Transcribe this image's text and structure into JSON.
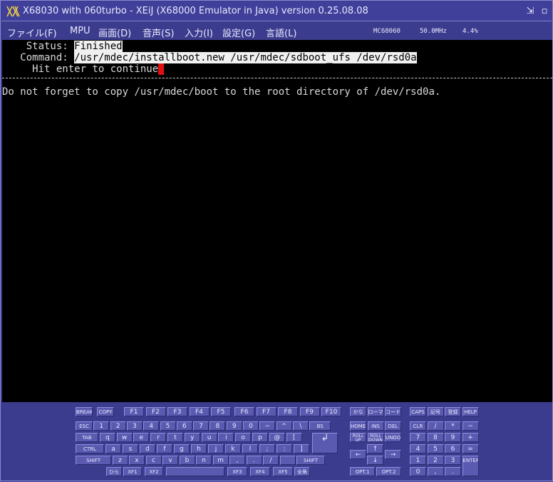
{
  "window": {
    "title": "X68030 with 060turbo - XEiJ (X68000 Emulator in Java) version 0.25.08.08",
    "logo_icon": "x68k-logo-icon",
    "restore_icon": "⇲",
    "close_icon": "▫"
  },
  "menu": {
    "file": "ファイル(F)",
    "mpu": "MPU",
    "screen": "画面(D)",
    "sound": "音声(S)",
    "input": "入力(I)",
    "settings": "設定(G)",
    "language": "言語(L)"
  },
  "status": {
    "cpu": "MC68060",
    "clock": "50.0MHz",
    "load": "4.4%"
  },
  "terminal": {
    "status_label": "    Status: ",
    "status_value": "Finished",
    "command_label": "   Command: ",
    "command_value": "/usr/mdec/installboot.new /usr/mdec/sdboot_ufs /dev/rsd0a",
    "prompt": "     Hit enter to continue",
    "message": "Do not forget to copy /usr/mdec/boot to the root directory of /dev/rsd0a.",
    "cursor_color": "#e01010"
  },
  "keyboard": {
    "row0_left": [
      "BREAK",
      "COPY"
    ],
    "function_keys_a": [
      "F1",
      "F2",
      "F3",
      "F4",
      "F5"
    ],
    "function_keys_b": [
      "F6",
      "F7",
      "F8",
      "F9",
      "F10"
    ],
    "mode_keys": [
      "かな",
      "ローマ",
      "コード"
    ],
    "row0_right": [
      "CAPS",
      "記号",
      "登録",
      "HELP"
    ],
    "row1": [
      "ESC",
      "1",
      "2",
      "3",
      "4",
      "5",
      "6",
      "7",
      "8",
      "9",
      "0",
      "−",
      "^",
      "\\",
      "BS"
    ],
    "row2": [
      "TAB",
      "q",
      "w",
      "e",
      "r",
      "t",
      "y",
      "u",
      "i",
      "o",
      "p",
      "@",
      "["
    ],
    "row3": [
      "CTRL",
      "a",
      "s",
      "d",
      "f",
      "g",
      "h",
      "j",
      "k",
      "l",
      ";",
      ":",
      "]"
    ],
    "row4": [
      "SHIFT",
      "z",
      "x",
      "c",
      "v",
      "b",
      "n",
      "m",
      ",",
      ".",
      "/",
      "",
      "SHIFT"
    ],
    "row5": [
      "ひら",
      "XF1",
      "XF2",
      "",
      "XF3",
      "XF4",
      "XF5",
      "全角"
    ],
    "enter": "↲",
    "nav_top": [
      "HOME",
      "INS",
      "DEL"
    ],
    "nav_mid": [
      "ROLL UP",
      "ROLL DOWN",
      "UNDO"
    ],
    "arrows": [
      "↑",
      "←",
      "→",
      "↓"
    ],
    "opt": [
      "OPT.1",
      "OPT.2"
    ],
    "numpad": [
      "CLR",
      "/",
      "*",
      "−",
      "7",
      "8",
      "9",
      "+",
      "4",
      "5",
      "6",
      "=",
      "1",
      "2",
      "3",
      "0",
      ",",
      ".",
      "ENTER"
    ]
  }
}
